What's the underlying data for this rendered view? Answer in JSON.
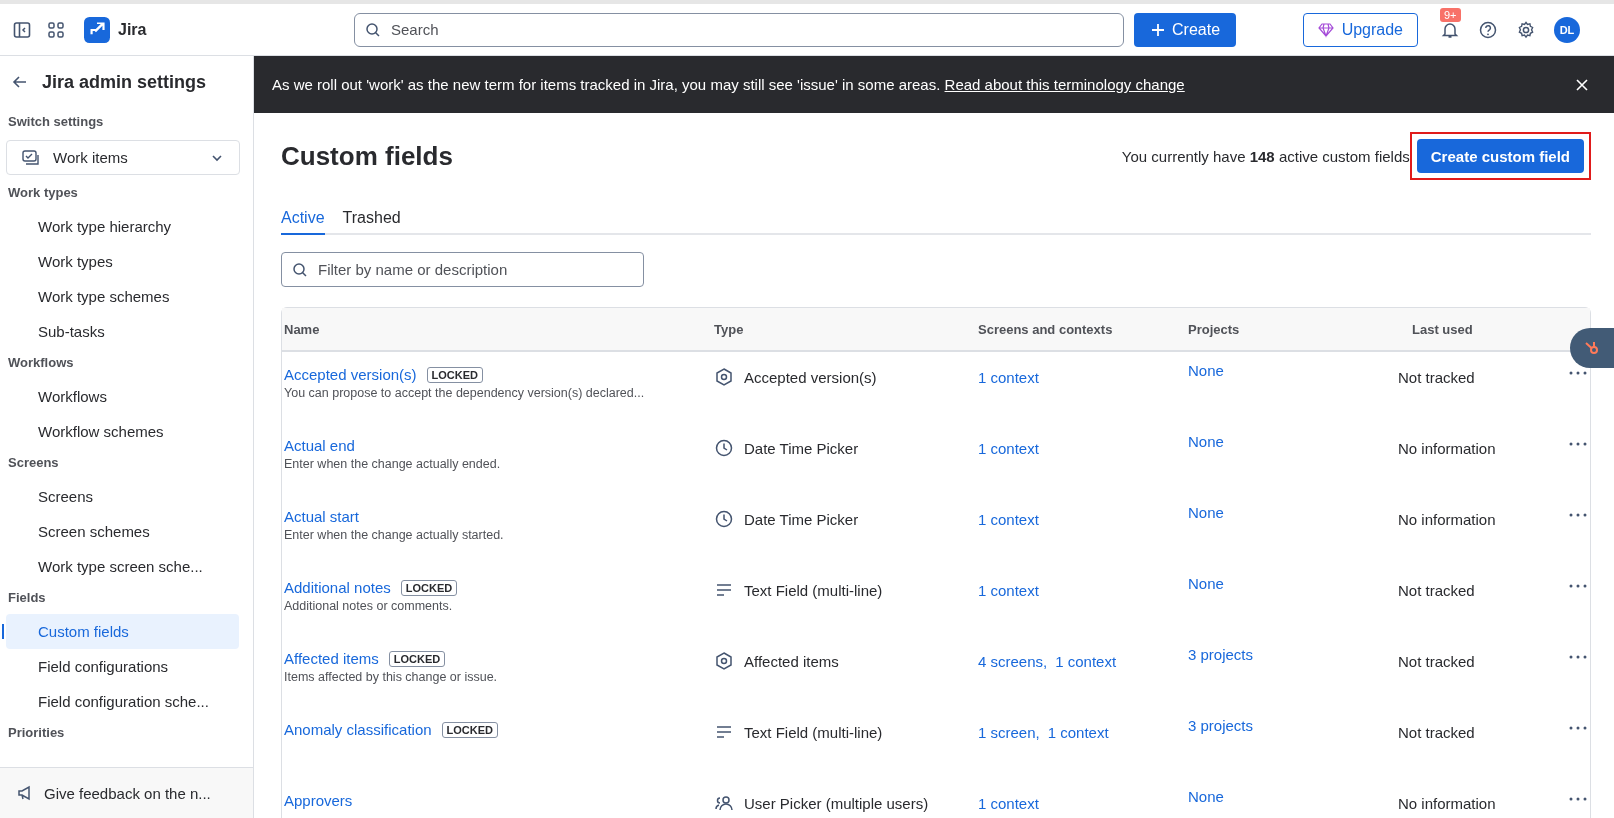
{
  "topbar": {
    "product": "Jira",
    "search": {
      "placeholder": "Search"
    },
    "create": "Create",
    "upgrade": "Upgrade",
    "notifications": "9+",
    "avatar": "DL"
  },
  "sidebar": {
    "back": "Jira admin settings",
    "switch_label": "Switch settings",
    "switcher": "Work items",
    "sections": [
      {
        "heading": "Work types",
        "items": [
          {
            "label": "Work type hierarchy",
            "selected": false
          },
          {
            "label": "Work types",
            "selected": false
          },
          {
            "label": "Work type schemes",
            "selected": false
          },
          {
            "label": "Sub-tasks",
            "selected": false
          }
        ]
      },
      {
        "heading": "Workflows",
        "items": [
          {
            "label": "Workflows",
            "selected": false
          },
          {
            "label": "Workflow schemes",
            "selected": false
          }
        ]
      },
      {
        "heading": "Screens",
        "items": [
          {
            "label": "Screens",
            "selected": false
          },
          {
            "label": "Screen schemes",
            "selected": false
          },
          {
            "label": "Work type screen sche...",
            "selected": false
          }
        ]
      },
      {
        "heading": "Fields",
        "items": [
          {
            "label": "Custom fields",
            "selected": true
          },
          {
            "label": "Field configurations",
            "selected": false
          },
          {
            "label": "Field configuration sche...",
            "selected": false
          }
        ]
      },
      {
        "heading": "Priorities"
      }
    ],
    "feedback": "Give feedback on the n..."
  },
  "banner": {
    "text": "As we roll out 'work' as the new term for items tracked in Jira, you may still see 'issue' in some areas.",
    "link": "Read about this terminology change"
  },
  "page": {
    "title": "Custom fields",
    "summary": "You currently have **148** active custom fields",
    "create_button": {
      "label": "Create custom field",
      "highlighted": true
    },
    "tabs": [
      {
        "label": "Active",
        "selected": true
      },
      {
        "label": "Trashed",
        "selected": false
      }
    ],
    "filter": {
      "placeholder": "Filter by name or description"
    }
  },
  "table": {
    "columns": [
      "Name",
      "Type",
      "Screens and contexts",
      "Projects",
      "Last used"
    ],
    "rows": [
      {
        "name": "Accepted version(s)",
        "locked": true,
        "badge": "LOCKED",
        "description": "You can propose to accept the dependency version(s) declared...",
        "kind": "hexagon",
        "type": "Accepted version(s)",
        "contexts": [
          "1 context"
        ],
        "projects": "None",
        "last_used": "Not tracked"
      },
      {
        "name": "Actual end",
        "locked": false,
        "description": "Enter when the change actually ended.",
        "kind": "clock",
        "type": "Date Time Picker",
        "contexts": [
          "1 context"
        ],
        "projects": "None",
        "last_used": "No information"
      },
      {
        "name": "Actual start",
        "locked": false,
        "description": "Enter when the change actually started.",
        "kind": "clock",
        "type": "Date Time Picker",
        "contexts": [
          "1 context"
        ],
        "projects": "None",
        "last_used": "No information"
      },
      {
        "name": "Additional notes",
        "locked": true,
        "badge": "LOCKED",
        "description": "Additional notes or comments.",
        "kind": "lines",
        "type": "Text Field (multi-line)",
        "contexts": [
          "1 context"
        ],
        "projects": "None",
        "last_used": "Not tracked"
      },
      {
        "name": "Affected items",
        "locked": true,
        "badge": "LOCKED",
        "description": "Items affected by this change or issue.",
        "kind": "hexagon",
        "type": "Affected items",
        "contexts": [
          "4 screens,",
          "1 context"
        ],
        "projects": "3 projects",
        "last_used": "Not tracked"
      },
      {
        "name": "Anomaly classification",
        "locked": true,
        "badge": "LOCKED",
        "kind": "lines",
        "type": "Text Field (multi-line)",
        "contexts": [
          "1 screen,",
          "1 context"
        ],
        "projects": "3 projects",
        "last_used": "Not tracked"
      },
      {
        "name": "Approvers",
        "locked": false,
        "kind": "users",
        "type": "User Picker (multiple users)",
        "contexts": [
          "1 context"
        ],
        "projects": "None",
        "last_used": "No information"
      }
    ]
  }
}
